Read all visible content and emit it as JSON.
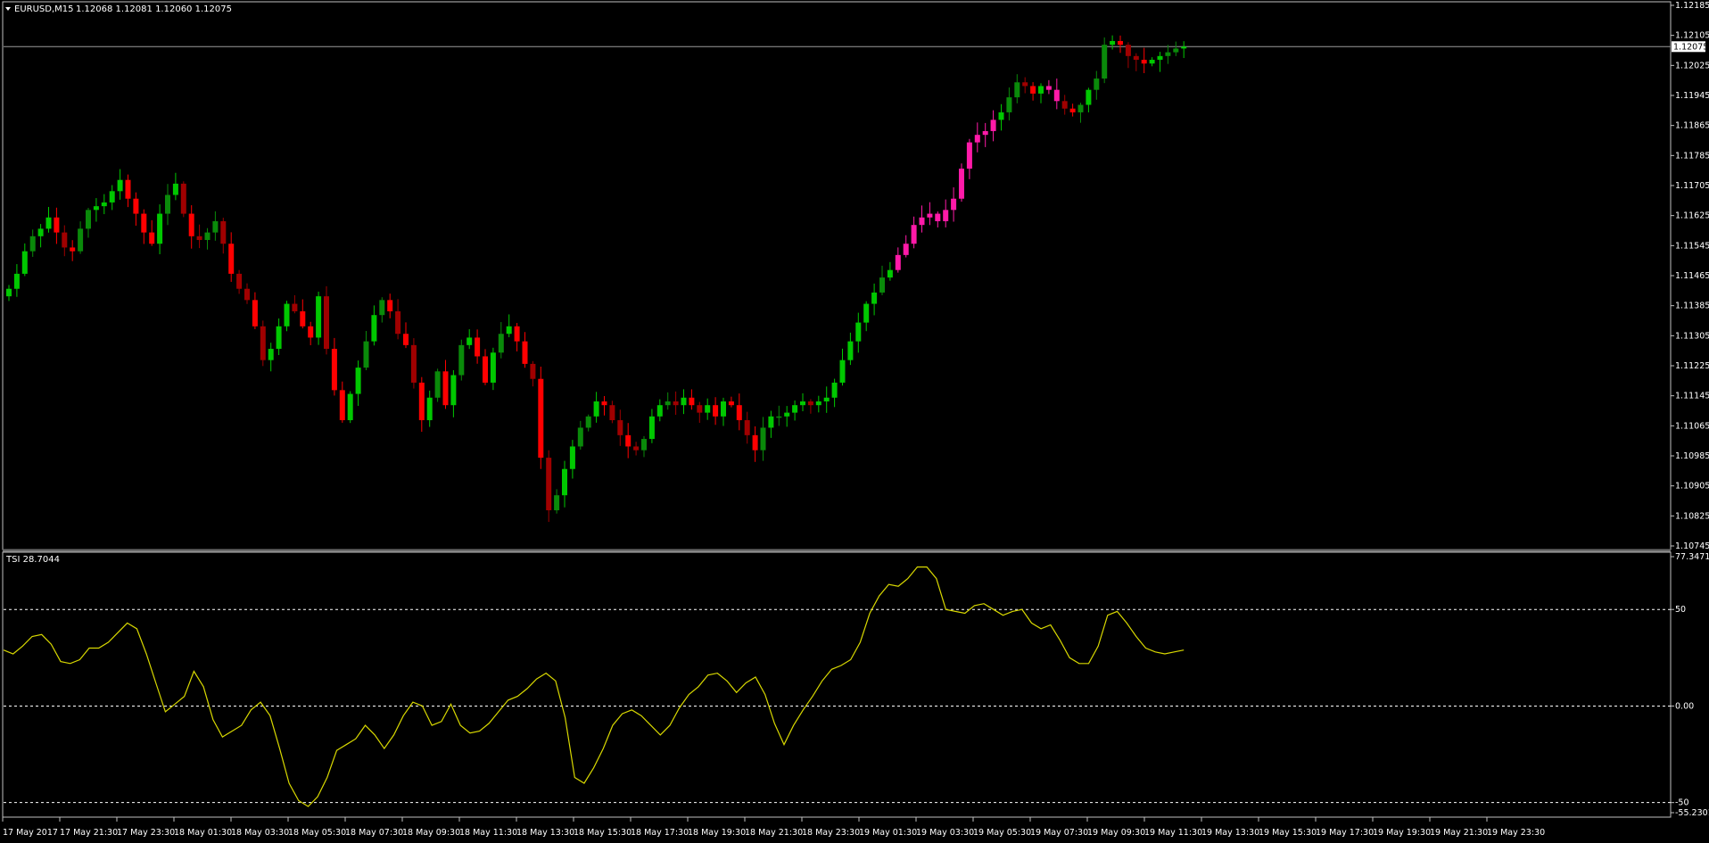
{
  "window": {
    "symbol_label": "EURUSD,M15",
    "ohlc_label": "1.12068 1.12081 1.12060 1.12075",
    "current_price": "1.12075"
  },
  "colors": {
    "background": "#000000",
    "frame": "#c0c0c0",
    "bull": "#00c800",
    "bull_dark": "#0a8a0a",
    "bear": "#ff0000",
    "bear_dark": "#a00000",
    "magenta": "#ff1aa8",
    "tsi_line": "#d8d800",
    "level_line": "#ffffff"
  },
  "icons": {
    "dropdown": "triangle-down-icon"
  },
  "price_axis": {
    "ticks": [
      "1.12185",
      "1.12105",
      "1.12025",
      "1.11945",
      "1.11865",
      "1.11785",
      "1.11705",
      "1.11625",
      "1.11545",
      "1.11465",
      "1.11385",
      "1.11305",
      "1.11225",
      "1.11145",
      "1.11065",
      "1.10985",
      "1.10905",
      "1.10825",
      "1.10745"
    ]
  },
  "indicator": {
    "label": "TSI 28.7044",
    "axis_ticks": [
      "77.3471",
      "50",
      "0.00",
      "-50",
      "-55.2301"
    ]
  },
  "time_axis": {
    "ticks": [
      "17 May 2017",
      "17 May 21:30",
      "17 May 23:30",
      "18 May 01:30",
      "18 May 03:30",
      "18 May 05:30",
      "18 May 07:30",
      "18 May 09:30",
      "18 May 11:30",
      "18 May 13:30",
      "18 May 15:30",
      "18 May 17:30",
      "18 May 19:30",
      "18 May 21:30",
      "18 May 23:30",
      "19 May 01:30",
      "19 May 03:30",
      "19 May 05:30",
      "19 May 07:30",
      "19 May 09:30",
      "19 May 11:30",
      "19 May 13:30",
      "19 May 15:30",
      "19 May 17:30",
      "19 May 19:30",
      "19 May 21:30",
      "19 May 23:30"
    ]
  },
  "chart_data": [
    {
      "type": "candlestick",
      "title": "EURUSD,M15",
      "ylim": [
        1.10745,
        1.12185
      ],
      "current_price": 1.12075,
      "x_ticks": [
        "17 May 2017",
        "17 May 21:30",
        "17 May 23:30",
        "18 May 01:30",
        "18 May 03:30",
        "18 May 05:30",
        "18 May 07:30",
        "18 May 09:30",
        "18 May 11:30",
        "18 May 13:30",
        "18 May 15:30",
        "18 May 17:30",
        "18 May 19:30",
        "18 May 21:30",
        "18 May 23:30",
        "19 May 01:30",
        "19 May 03:30",
        "19 May 05:30",
        "19 May 07:30",
        "19 May 09:30",
        "19 May 11:30",
        "19 May 13:30",
        "19 May 15:30",
        "19 May 17:30",
        "19 May 19:30",
        "19 May 21:30",
        "19 May 23:30"
      ],
      "close": [
        1.1143,
        1.1147,
        1.1153,
        1.1157,
        1.1159,
        1.1162,
        1.1158,
        1.1154,
        1.1153,
        1.1159,
        1.1164,
        1.1165,
        1.1166,
        1.1169,
        1.1172,
        1.1167,
        1.1163,
        1.1158,
        1.1155,
        1.1163,
        1.1168,
        1.1171,
        1.1163,
        1.1157,
        1.1156,
        1.1158,
        1.1161,
        1.1155,
        1.1147,
        1.1143,
        1.114,
        1.1133,
        1.1124,
        1.1127,
        1.1133,
        1.1139,
        1.1137,
        1.1133,
        1.113,
        1.1141,
        1.1127,
        1.1116,
        1.1108,
        1.1115,
        1.1122,
        1.1129,
        1.1136,
        1.114,
        1.1137,
        1.1131,
        1.1128,
        1.1118,
        1.1108,
        1.1114,
        1.1121,
        1.1112,
        1.112,
        1.1128,
        1.113,
        1.1125,
        1.1118,
        1.1126,
        1.1131,
        1.1133,
        1.1129,
        1.1123,
        1.1119,
        1.1098,
        1.1084,
        1.1088,
        1.1095,
        1.1101,
        1.1106,
        1.1109,
        1.1113,
        1.1112,
        1.1108,
        1.1104,
        1.1101,
        1.11,
        1.1103,
        1.1109,
        1.1112,
        1.1113,
        1.1112,
        1.1114,
        1.1112,
        1.111,
        1.1112,
        1.1109,
        1.1113,
        1.1112,
        1.1108,
        1.1104,
        1.11,
        1.1106,
        1.1109,
        1.1109,
        1.111,
        1.1112,
        1.1113,
        1.1112,
        1.1113,
        1.1114,
        1.1118,
        1.1124,
        1.1129,
        1.1134,
        1.1139,
        1.1142,
        1.1146,
        1.1148,
        1.1152,
        1.1155,
        1.116,
        1.1162,
        1.1163,
        1.1161,
        1.1164,
        1.1167,
        1.1175,
        1.1182,
        1.1184,
        1.1185,
        1.1188,
        1.119,
        1.1194,
        1.1198,
        1.1197,
        1.1195,
        1.1197,
        1.1196,
        1.1193,
        1.1191,
        1.119,
        1.1192,
        1.1196,
        1.1199,
        1.1208,
        1.1209,
        1.1208,
        1.1205,
        1.1204,
        1.1203,
        1.1204,
        1.1205,
        1.1206,
        1.1207,
        1.12075
      ]
    },
    {
      "type": "line",
      "title": "TSI 28.7044",
      "ylim": [
        -55.2301,
        77.3471
      ],
      "levels": [
        50,
        0,
        -50
      ],
      "series": [
        {
          "values": [
            29,
            27,
            31,
            36,
            37,
            32,
            23,
            22,
            24,
            30,
            30,
            33,
            38,
            43,
            40,
            27,
            12,
            -3,
            1,
            5,
            18,
            10,
            -7,
            -16,
            -13,
            -10,
            -2,
            2,
            -5,
            -22,
            -40,
            -49,
            -52,
            -47,
            -37,
            -23,
            -20,
            -17,
            -10,
            -15,
            -22,
            -15,
            -5,
            2,
            0,
            -10,
            -8,
            1,
            -10,
            -14,
            -13,
            -9,
            -3,
            3,
            5,
            9,
            14,
            17,
            13,
            -6,
            -37,
            -40,
            -32,
            -22,
            -10,
            -4,
            -2,
            -5,
            -10,
            -15,
            -10,
            -1,
            6,
            10,
            16,
            17,
            13,
            7,
            12,
            15,
            6,
            -9,
            -20,
            -10,
            -2,
            5,
            13,
            19,
            21,
            24,
            33,
            48,
            57,
            63,
            62,
            66,
            72,
            72,
            66,
            50,
            49,
            48,
            52,
            53,
            50,
            47,
            49,
            50,
            43,
            40,
            42,
            34,
            25,
            22,
            22,
            31,
            47,
            49,
            43,
            36,
            30,
            28,
            27,
            28,
            29
          ]
        }
      ]
    }
  ]
}
